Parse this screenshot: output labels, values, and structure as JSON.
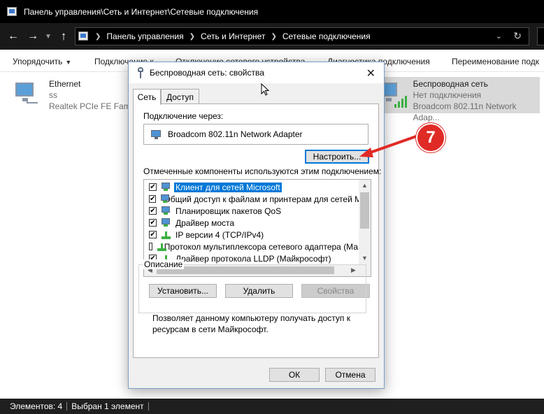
{
  "window": {
    "title": "Панель управления\\Сеть и Интернет\\Сетевые подключения"
  },
  "address": {
    "crumbs": [
      "Панель управления",
      "Сеть и Интернет",
      "Сетевые подключения"
    ]
  },
  "toolbar": {
    "organize": "Упорядочить",
    "connect_to": "Подключение к",
    "disable_device": "Отключение сетевого устройства",
    "diagnose": "Диагностика подключения",
    "rename": "Переименование подк"
  },
  "connections": [
    {
      "name": "Ethernet",
      "network": "ss",
      "adapter": "Realtek PCIe FE Famil"
    },
    {
      "name": "Беспроводная сеть",
      "network": "Нет подключения",
      "adapter": "Broadcom 802.11n Network Adap..."
    }
  ],
  "status": {
    "items_count": "Элементов: 4",
    "selected": "Выбран 1 элемент"
  },
  "dialog": {
    "title": "Беспроводная сеть: свойства",
    "tabs": [
      "Сеть",
      "Доступ"
    ],
    "connect_using_label": "Подключение через:",
    "adapter_name": "Broadcom 802.11n Network Adapter",
    "configure_button": "Настроить...",
    "components_label": "Отмеченные компоненты используются этим подключением:",
    "components": [
      {
        "label": "Клиент для сетей Microsoft",
        "checked": true,
        "selected": true,
        "icon": "client-icon"
      },
      {
        "label": "Общий доступ к файлам и принтерам для сетей Mi",
        "checked": true,
        "selected": false,
        "icon": "service-icon"
      },
      {
        "label": "Планировщик пакетов QoS",
        "checked": true,
        "selected": false,
        "icon": "service-icon"
      },
      {
        "label": "Драйвер моста",
        "checked": true,
        "selected": false,
        "icon": "service-icon"
      },
      {
        "label": "IP версии 4 (TCP/IPv4)",
        "checked": true,
        "selected": false,
        "icon": "protocol-icon"
      },
      {
        "label": "Протокол мультиплексора сетевого адаптера (Ма",
        "checked": false,
        "selected": false,
        "icon": "protocol-icon"
      },
      {
        "label": "Драйвер протокола LLDP (Майкрософт)",
        "checked": true,
        "selected": false,
        "icon": "protocol-icon"
      }
    ],
    "install_button": "Установить...",
    "uninstall_button": "Удалить",
    "properties_button": "Свойства",
    "description_legend": "Описание",
    "description_text": "Позволяет данному компьютеру получать доступ к ресурсам в сети Майкрософт.",
    "ok_button": "ОК",
    "cancel_button": "Отмена"
  },
  "annotation": {
    "step_number": "7",
    "color": "#e02a26"
  },
  "colors": {
    "selection": "#0078d7",
    "titlebar": "#000000"
  }
}
